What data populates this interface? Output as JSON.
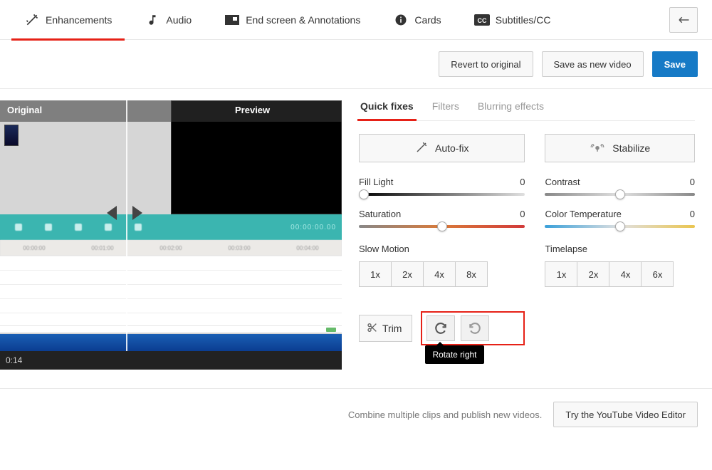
{
  "tabs": {
    "enhancements": "Enhancements",
    "audio": "Audio",
    "endscreen": "End screen & Annotations",
    "cards": "Cards",
    "subtitles": "Subtitles/CC"
  },
  "actions": {
    "revert": "Revert to original",
    "save_as_new": "Save as new video",
    "save": "Save"
  },
  "preview": {
    "original_label": "Original",
    "preview_label": "Preview",
    "timecode": "0:14",
    "timeline_time": "00:00:00.00"
  },
  "subtabs": {
    "quick_fixes": "Quick fixes",
    "filters": "Filters",
    "blurring": "Blurring effects"
  },
  "buttons": {
    "autofix": "Auto-fix",
    "stabilize": "Stabilize",
    "trim": "Trim"
  },
  "sliders": {
    "fill_light": {
      "label": "Fill Light",
      "value": "0"
    },
    "contrast": {
      "label": "Contrast",
      "value": "0"
    },
    "saturation": {
      "label": "Saturation",
      "value": "0"
    },
    "color_temp": {
      "label": "Color Temperature",
      "value": "0"
    }
  },
  "speed": {
    "slow_label": "Slow Motion",
    "slow_options": [
      "1x",
      "2x",
      "4x",
      "8x"
    ],
    "time_label": "Timelapse",
    "time_options": [
      "1x",
      "2x",
      "4x",
      "6x"
    ]
  },
  "tooltip": {
    "rotate_right": "Rotate right"
  },
  "footer": {
    "text": "Combine multiple clips and publish new videos.",
    "button": "Try the YouTube Video Editor"
  }
}
